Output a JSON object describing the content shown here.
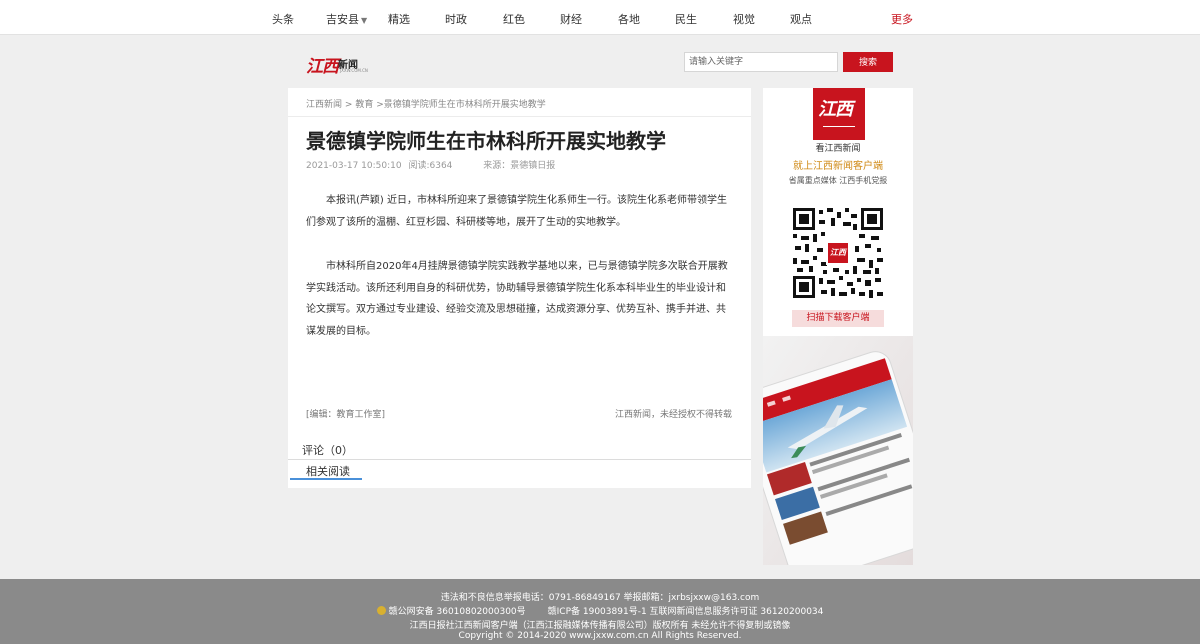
{
  "nav": {
    "items": [
      "头条",
      "吉安县",
      "精选",
      "时政",
      "红色",
      "财经",
      "各地",
      "民生",
      "视觉",
      "观点"
    ],
    "more": "更多",
    "dropdown_icon": "caret-down-icon"
  },
  "brand": {
    "logo_script": "江西",
    "logo_text": "新闻",
    "logo_sub": "JXXW.COM.CN"
  },
  "search": {
    "placeholder": "请输入关键字",
    "button_label": "搜索"
  },
  "breadcrumb": {
    "items": [
      "江西新闻",
      "教育",
      "景德镇学院师生在市林科所开展实地教学"
    ],
    "separator": ">"
  },
  "article": {
    "title": "景德镇学院师生在市林科所开展实地教学",
    "date": "2021-03-17 10:50:10",
    "reads": "阅读:6364",
    "source": "来源：景德镇日报",
    "paragraphs": [
      "本报讯(芦颖) 近日，市林科所迎来了景德镇学院生化系师生一行。该院生化系老师带领学生们参观了该所的温棚、红豆杉园、科研楼等地，展开了生动的实地教学。",
      "市林科所自2020年4月挂牌景德镇学院实践教学基地以来，已与景德镇学院多次联合开展教学实践活动。该所还利用自身的科研优势，协助辅导景德镇学院生化系本科毕业生的毕业设计和论文撰写。双方通过专业建设、经验交流及思想碰撞，达成资源分享、优势互补、携手并进、共谋发展的目标。"
    ],
    "editor": "[编辑：教育工作室]",
    "rights": "江西新闻，未经授权不得转载",
    "tab_comment": "评论（0）",
    "tab_related": "相关阅读"
  },
  "sidebar": {
    "badge_text": "江西",
    "caption1": "看江西新闻",
    "caption2": "就上江西新闻客户端",
    "caption3": "省属重点媒体 江西手机党报",
    "download_label": "扫描下载客户端",
    "accent": "#c8141e"
  },
  "footer": {
    "line1": "违法和不良信息举报电话：0791-86849167  举报邮箱：jxrbsjxxw@163.com",
    "line2a": "赣公网安备 36010802000300号",
    "line2b": "赣ICP备 19003891号-1 互联网新闻信息服务许可证 36120200034",
    "line3": "江西日报社江西新闻客户端（江西江报融媒体传播有限公司）版权所有 未经允许不得复制或镜像",
    "line4": "Copyright © 2014-2020 www.jxxw.com.cn All Rights Reserved."
  }
}
